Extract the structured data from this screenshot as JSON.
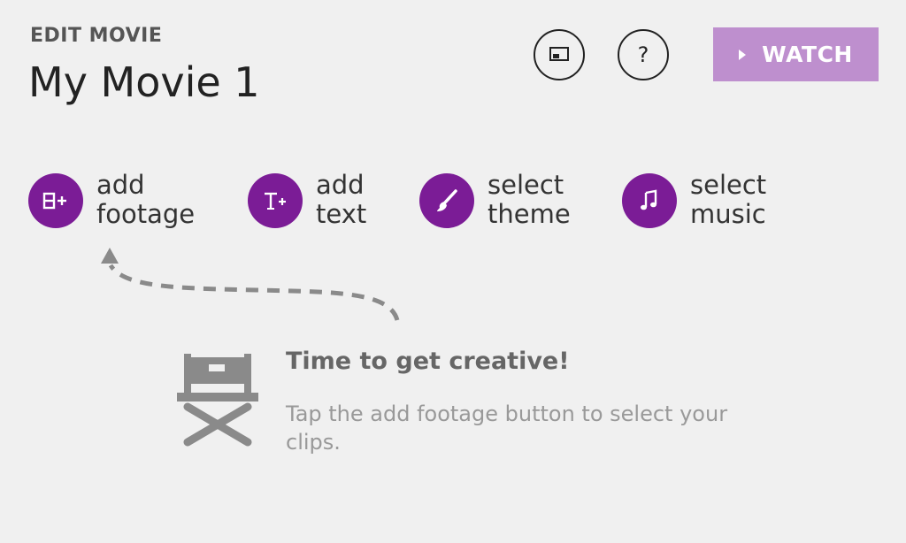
{
  "header": {
    "section_label": "EDIT MOVIE",
    "movie_title": "My Movie 1"
  },
  "toolbar": {
    "cast_icon": "cast-screen-icon",
    "help_icon": "help-icon",
    "help_glyph": "?",
    "watch_label": "WATCH",
    "watch_icon": "play-icon"
  },
  "actions": [
    {
      "id": "add-footage",
      "line1": "add",
      "line2": "footage",
      "icon": "add-footage-icon"
    },
    {
      "id": "add-text",
      "line1": "add",
      "line2": "text",
      "icon": "add-text-icon"
    },
    {
      "id": "select-theme",
      "line1": "select",
      "line2": "theme",
      "icon": "paintbrush-icon"
    },
    {
      "id": "select-music",
      "line1": "select",
      "line2": "music",
      "icon": "music-note-icon"
    }
  ],
  "empty_state": {
    "title": "Time to get creative!",
    "subtitle": "Tap the add footage button to select your clips.",
    "icon": "directors-chair-icon"
  },
  "colors": {
    "accent_purple": "#7b1c96",
    "watch_button": "#be8fce",
    "background": "#f0f0f0"
  }
}
